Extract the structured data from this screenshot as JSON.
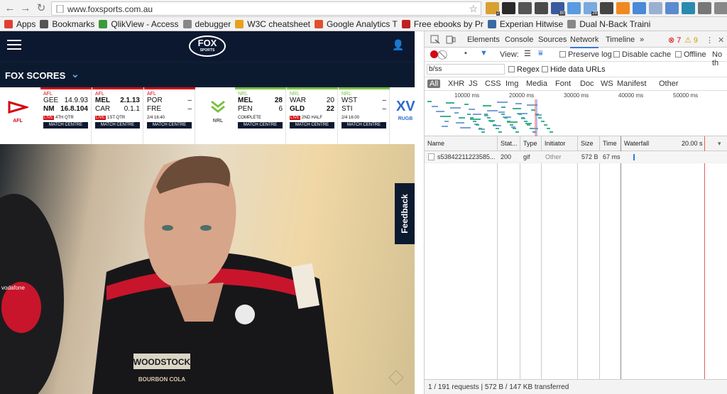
{
  "browser": {
    "url": "www.foxsports.com.au",
    "bookmarks": [
      {
        "label": "Apps",
        "icon": "apps-grid-icon",
        "color": "#e04030"
      },
      {
        "label": "Bookmarks",
        "icon": "star-icon",
        "color": "#555555"
      },
      {
        "label": "QlikView - Access",
        "icon": "qlikview-icon",
        "color": "#3a9a3a"
      },
      {
        "label": "debugger",
        "icon": "doc-icon",
        "color": "#888888"
      },
      {
        "label": "W3C cheatsheet",
        "icon": "w3c-icon",
        "color": "#e8a020"
      },
      {
        "label": "Google Analytics T",
        "icon": "google-icon",
        "color": "#e05030"
      },
      {
        "label": "Free ebooks by Pr",
        "icon": "ebook-icon",
        "color": "#c02020"
      },
      {
        "label": "Experian Hitwise",
        "icon": "grid-icon",
        "color": "#3a6aa0"
      },
      {
        "label": "Dual N-Back Traini",
        "icon": "doc-icon",
        "color": "#888888"
      }
    ],
    "extensions": [
      {
        "icon": "ext-1-icon",
        "color": "#d8a030",
        "badge": "2"
      },
      {
        "icon": "ext-k-icon",
        "color": "#2a2a2a",
        "badge": ""
      },
      {
        "icon": "evernote-icon",
        "color": "#555555",
        "badge": ""
      },
      {
        "icon": "ext-clip-icon",
        "color": "#4a4a4a",
        "badge": ""
      },
      {
        "icon": "w-icon",
        "color": "#3a5aa0",
        "badge": "80"
      },
      {
        "icon": "ext-blue-icon",
        "color": "#5a9ae0",
        "badge": ""
      },
      {
        "icon": "ext-calendar-icon",
        "color": "#7aa8e0",
        "badge": "29"
      },
      {
        "icon": "pen-icon",
        "color": "#444444",
        "badge": ""
      },
      {
        "icon": "ext-orange-icon",
        "color": "#f08a20",
        "badge": ""
      },
      {
        "icon": "ext-graph-icon",
        "color": "#4a8ad8",
        "badge": ""
      },
      {
        "icon": "ext-op-icon",
        "color": "#9ab0d0",
        "badge": ""
      },
      {
        "icon": "ext-grid-icon",
        "color": "#5a8ad0",
        "badge": ""
      },
      {
        "icon": "ext-circle-icon",
        "color": "#2a8ab0",
        "badge": ""
      },
      {
        "icon": "ext-check-icon",
        "color": "#777777",
        "badge": ""
      },
      {
        "icon": "ext-gray-icon",
        "color": "#888888",
        "badge": ""
      },
      {
        "icon": "ext-green-icon",
        "color": "#3aa03a",
        "badge": ""
      },
      {
        "icon": "menu-dots-icon",
        "color": "#666666",
        "badge": ""
      }
    ]
  },
  "site": {
    "logo_main": "FOX",
    "logo_sub": "SPORTS",
    "scores_title": "FOX SCORES",
    "feedback": "Feedback",
    "afl_label": "AFL",
    "nrl_label": "NRL",
    "rugby_label": "RUGB",
    "rugby_logo": "XV",
    "cards": [
      {
        "league": "AFL",
        "bar": "#d20a11",
        "r1": [
          "GEE",
          "14.9.93"
        ],
        "r2": [
          "NM",
          "16.8.104"
        ],
        "bold": 2,
        "live": "LIVE",
        "status": "4TH QTR",
        "cta": "MATCH CENTRE"
      },
      {
        "league": "AFL",
        "bar": "#d20a11",
        "r1": [
          "MEL",
          "2.1.13"
        ],
        "r2": [
          "CAR",
          "0.1.1"
        ],
        "bold": 1,
        "live": "LIVE",
        "status": "1ST QTR",
        "cta": "MATCH CENTRE"
      },
      {
        "league": "AFL",
        "bar": "#d20a11",
        "r1": [
          "POR",
          "–"
        ],
        "r2": [
          "FRE",
          "–"
        ],
        "bold": 0,
        "live": "",
        "status": "2/4 16:40",
        "cta": "MATCH CENTRE"
      },
      {
        "league": "NRL",
        "bar": "#7ac142",
        "r1": [
          "MEL",
          "28"
        ],
        "r2": [
          "PEN",
          "6"
        ],
        "bold": 1,
        "live": "",
        "status": "COMPLETE",
        "cta": "MATCH CENTRE"
      },
      {
        "league": "NRL",
        "bar": "#7ac142",
        "r1": [
          "WAR",
          "20"
        ],
        "r2": [
          "GLD",
          "22"
        ],
        "bold": 2,
        "live": "LIVE",
        "status": "2ND HALF",
        "cta": "MATCH CENTRE"
      },
      {
        "league": "NRL",
        "bar": "#7ac142",
        "r1": [
          "WST",
          "–"
        ],
        "r2": [
          "STI",
          "–"
        ],
        "bold": 0,
        "live": "",
        "status": "2/4 16:00",
        "cta": "MATCH CENTRE"
      }
    ],
    "photo_text": {
      "jersey_brand": "WOODSTOCK",
      "jersey_sub": "BOURBON COLA",
      "sleeve": "vodafone"
    }
  },
  "devtools": {
    "tabs": [
      "Elements",
      "Console",
      "Sources",
      "Network",
      "Timeline"
    ],
    "selected_tab": "Network",
    "more": "»",
    "errors": "7",
    "warnings": "9",
    "view_label": "View:",
    "preserve_log": "Preserve log",
    "disable_cache": "Disable cache",
    "offline": "Offline",
    "throttle": "No th",
    "filter_value": "b/ss",
    "regex": "Regex",
    "hide_data": "Hide data URLs",
    "types": [
      "All",
      "XHR",
      "JS",
      "CSS",
      "Img",
      "Media",
      "Font",
      "Doc",
      "WS",
      "Manifest",
      "Other"
    ],
    "ticks": [
      "10000 ms",
      "20000 ms",
      "30000 ms",
      "40000 ms",
      "50000 ms"
    ],
    "columns": [
      "Name",
      "Stat...",
      "Type",
      "Initiator",
      "Size",
      "Time",
      "Waterfall"
    ],
    "waterfall_tick": "20.00 s",
    "request": {
      "name": "s53842211223585...",
      "status": "200",
      "type": "gif",
      "initiator": "Other",
      "size": "572 B",
      "time": "67 ms"
    },
    "summary": "1 / 191 requests  |  572 B / 147 KB transferred"
  }
}
